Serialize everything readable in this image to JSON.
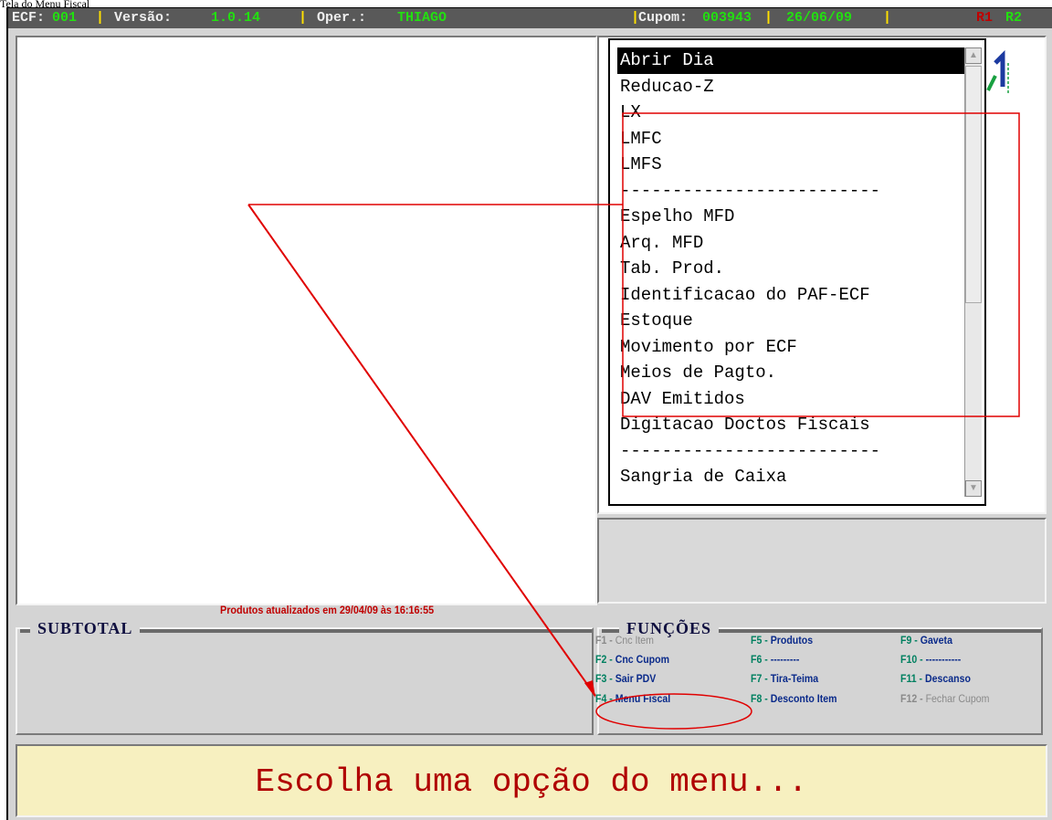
{
  "caption": "Tela do Menu Fiscal",
  "status": {
    "ecf_label": "ECF:",
    "ecf": "001",
    "versao_label": "Versão:",
    "versao": "1.0.14",
    "oper_label": "Oper.:",
    "oper": "THIAGO",
    "cupom_label": "Cupom:",
    "cupom": "003943",
    "date": "26/06/09",
    "sep": "|",
    "r1": "R1",
    "r2": "R2"
  },
  "menu": {
    "items": [
      "Abrir Dia",
      "Reducao-Z",
      "LX",
      "LMFC",
      "LMFS",
      "-------------------------",
      "Espelho MFD",
      "Arq. MFD",
      "Tab. Prod.",
      "Identificacao do PAF-ECF",
      "Estoque",
      "Movimento por ECF",
      "Meios de Pagto.",
      "DAV Emitidos",
      "Digitacao Doctos Fiscais",
      "-------------------------",
      "Sangria de Caixa"
    ],
    "selected_index": 0
  },
  "subtotal": {
    "title": "SUBTOTAL"
  },
  "updated_note": "Produtos atualizados em 29/04/09 às 16:16:55",
  "funcoes": {
    "title": "FUNÇÕES",
    "keys": [
      {
        "key": "F1",
        "label": "Cnc Item",
        "enabled": false
      },
      {
        "key": "F2",
        "label": "Cnc Cupom",
        "enabled": true
      },
      {
        "key": "F3",
        "label": "Sair PDV",
        "enabled": true
      },
      {
        "key": "F4",
        "label": "Menu Fiscal",
        "enabled": true
      },
      {
        "key": "F5",
        "label": "Produtos",
        "enabled": true
      },
      {
        "key": "F6",
        "label": "---------",
        "enabled": true
      },
      {
        "key": "F7",
        "label": "Tira-Teima",
        "enabled": true
      },
      {
        "key": "F8",
        "label": "Desconto Item",
        "enabled": true
      },
      {
        "key": "F9",
        "label": "Gaveta",
        "enabled": true
      },
      {
        "key": "F10",
        "label": "-----------",
        "enabled": true
      },
      {
        "key": "F11",
        "label": "Descanso",
        "enabled": true
      },
      {
        "key": "F12",
        "label": "Fechar Cupom",
        "enabled": false
      }
    ]
  },
  "prompt": "Escolha uma opção do menu...",
  "colors": {
    "annotation": "#e00000",
    "status_bg": "#595959",
    "status_value": "#22e010",
    "separator": "#ffe000"
  }
}
